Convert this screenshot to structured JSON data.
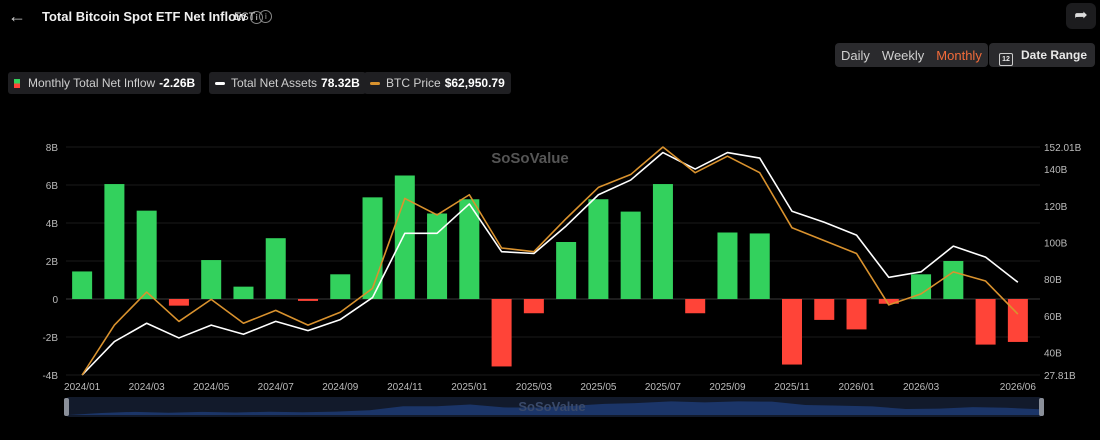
{
  "header": {
    "back_icon": "arrow-left-icon",
    "title": "Total Bitcoin Spot ETF Net Inflow",
    "timezone": "EST",
    "share_icon": "share-icon"
  },
  "controls": {
    "periods": [
      "Daily",
      "Weekly",
      "Monthly"
    ],
    "active_period": "Monthly",
    "date_range_label": "Date Range",
    "date_range_icon": "calendar-icon"
  },
  "legend": {
    "inflow_label": "Monthly Total Net Inflow",
    "inflow_value": "-2.26B",
    "assets_label": "Total Net Assets",
    "assets_value": "78.32B",
    "btc_label": "BTC Price",
    "btc_value": "$62,950.79"
  },
  "watermark": "SoSoValue",
  "colors": {
    "positive": "#33d15d",
    "negative": "#ff4438",
    "assets_line": "#ffffff",
    "btc_line": "#d9922e",
    "active_period": "#f26b3a",
    "navigator": "#1b3568"
  },
  "chart_data": {
    "type": "bar",
    "x_tick_labels": [
      "2024/01",
      "2024/03",
      "2024/05",
      "2024/07",
      "2024/09",
      "2024/11",
      "2025/01",
      "2025/03",
      "2025/05",
      "2025/07",
      "2025/09",
      "2025/11",
      "2026/01",
      "2026/03",
      "2026/06"
    ],
    "categories": [
      "2024/01",
      "2024/02",
      "2024/03",
      "2024/04",
      "2024/05",
      "2024/06",
      "2024/07",
      "2024/08",
      "2024/09",
      "2024/10",
      "2024/11",
      "2024/12",
      "2025/01",
      "2025/02",
      "2025/03",
      "2025/04",
      "2025/05",
      "2025/06",
      "2025/07",
      "2025/08",
      "2025/09",
      "2025/10",
      "2025/11",
      "2025/12",
      "2026/01",
      "2026/02",
      "2026/03",
      "2026/04",
      "2026/05",
      "2026/06"
    ],
    "left_axis": {
      "ticks": [
        "8B",
        "6B",
        "4B",
        "2B",
        "0",
        "-2B",
        "-4B"
      ],
      "min": -4,
      "max": 8
    },
    "right_axis": {
      "ticks": [
        "152.01B",
        "140B",
        "120B",
        "100B",
        "80B",
        "60B",
        "40B",
        "27.81B"
      ],
      "min": 27.81,
      "max": 152.01
    },
    "series": [
      {
        "kind": "bar",
        "values": [
          1.45,
          6.05,
          4.65,
          -0.35,
          2.05,
          0.65,
          3.2,
          -0.1,
          1.3,
          5.35,
          6.5,
          4.5,
          5.25,
          -3.55,
          -0.75,
          3.0,
          5.25,
          4.6,
          6.05,
          -0.75,
          3.5,
          3.45,
          -3.45,
          -1.1,
          -1.6,
          -0.25,
          1.3,
          2.0,
          -2.4,
          -2.26
        ]
      },
      {
        "kind": "line",
        "axis": "right",
        "values": [
          27.81,
          46,
          56,
          48,
          55,
          50,
          57,
          52,
          58,
          70,
          105,
          105,
          121,
          95,
          94,
          109,
          126,
          134,
          149,
          140,
          149,
          146,
          117,
          111,
          104,
          81,
          84,
          98,
          92,
          78.32
        ]
      },
      {
        "kind": "line",
        "axis": "right",
        "values": [
          27.81,
          55,
          73,
          57,
          69,
          56,
          63,
          55,
          62,
          75,
          124,
          115,
          126,
          97,
          95,
          113,
          130,
          137,
          152,
          138,
          147,
          138,
          108,
          101,
          94,
          66,
          72,
          84,
          79,
          61
        ]
      }
    ]
  }
}
